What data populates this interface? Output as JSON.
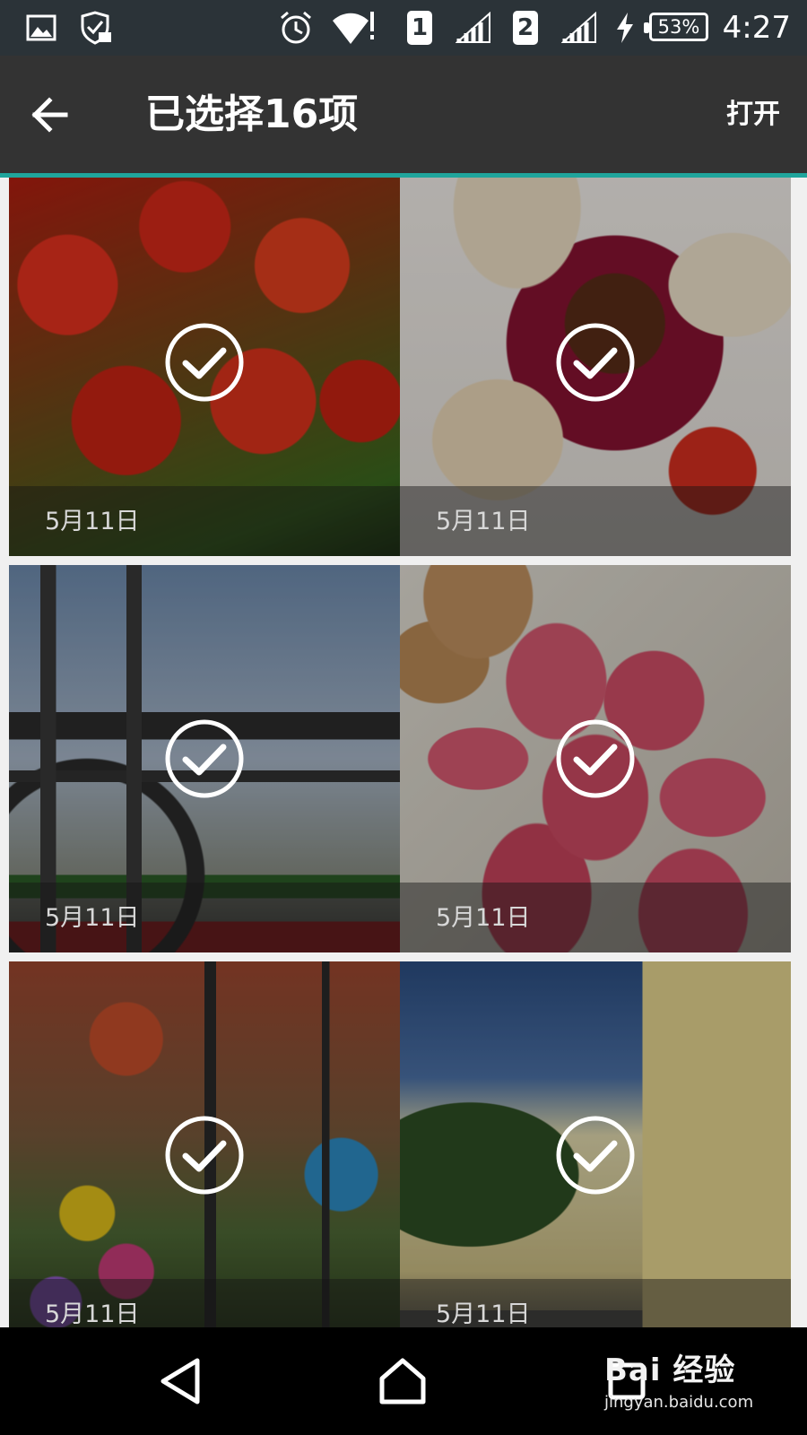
{
  "status_bar": {
    "time": "4:27",
    "battery_percent": "53%",
    "sim1_label": "1",
    "sim2_label": "2",
    "icons": [
      "gallery-icon",
      "shield-check-icon",
      "alarm-icon",
      "wifi-icon",
      "signal-icon",
      "charging-icon"
    ]
  },
  "app_bar": {
    "title": "已选择16项",
    "open_label": "打开",
    "accent_color": "#1fa59c"
  },
  "grid": {
    "items": [
      {
        "date": "5月11日",
        "subject": "tomatoes",
        "selected": true
      },
      {
        "date": "5月11日",
        "subject": "scallops",
        "selected": true
      },
      {
        "date": "5月11日",
        "subject": "eiffel-tower",
        "selected": true
      },
      {
        "date": "5月11日",
        "subject": "macarons",
        "selected": true
      },
      {
        "date": "5月11日",
        "subject": "market",
        "selected": true
      },
      {
        "date": "5月11日",
        "subject": "building",
        "selected": true
      }
    ]
  },
  "watermark": {
    "main": "Bai 经验",
    "sub": "jingyan.baidu.com"
  }
}
